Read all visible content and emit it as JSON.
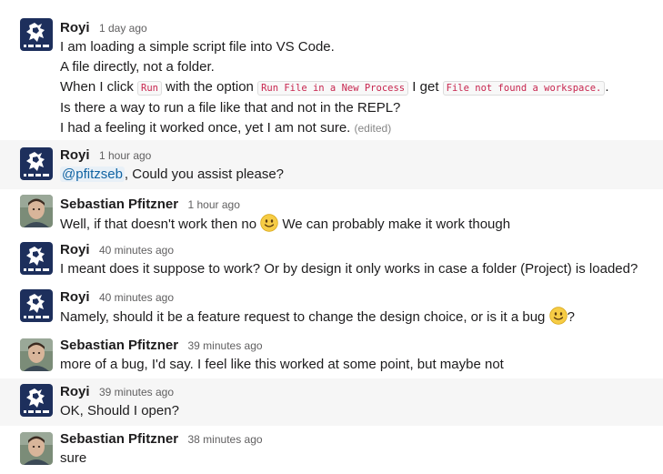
{
  "messages": [
    {
      "author": "Royi",
      "avatar": "royi-avatar",
      "time": "1 day ago",
      "lines": {
        "l1": "I am loading a simple script file into VS Code.",
        "l2": "A file directly, not a folder.",
        "l3a": "When I click",
        "l3code1": "Run",
        "l3b": "with the option",
        "l3code2": "Run File in a New Process",
        "l3c": "I get",
        "l3code3": "File not found a workspace.",
        "l3d": ".",
        "l4": "Is there a way to run a file like that and not in the REPL?",
        "l5": "I had a feeling it worked once, yet I am not sure.",
        "edited": "(edited)"
      }
    },
    {
      "author": "Royi",
      "avatar": "royi-avatar",
      "time": "1 hour ago",
      "mention": "@pfitzseb",
      "text": ", Could you assist please?"
    },
    {
      "author": "Sebastian Pfitzner",
      "avatar": "sebastian-avatar",
      "time": "1 hour ago",
      "text_a": "Well, if that doesn't work then no",
      "emoji": "slightly-smiling-face",
      "text_b": "We can probably make it work though"
    },
    {
      "author": "Royi",
      "avatar": "royi-avatar",
      "time": "40 minutes ago",
      "text": "I meant does it suppose to work? Or by design it only works in case a folder (Project) is loaded?"
    },
    {
      "author": "Royi",
      "avatar": "royi-avatar",
      "time": "40 minutes ago",
      "text_a": "Namely, should it be a feature request to change the design choice, or is it a bug",
      "emoji": "slightly-smiling-face",
      "text_b": "?"
    },
    {
      "author": "Sebastian Pfitzner",
      "avatar": "sebastian-avatar",
      "time": "39 minutes ago",
      "text": "more of a bug, I'd say. I feel like this worked at some point, but maybe not"
    },
    {
      "author": "Royi",
      "avatar": "royi-avatar",
      "time": "39 minutes ago",
      "text": "OK, Should I open?"
    },
    {
      "author": "Sebastian Pfitzner",
      "avatar": "sebastian-avatar",
      "time": "38 minutes ago",
      "text": "sure"
    }
  ],
  "colors": {
    "alt_row": "#f6f6f6",
    "mention": "#1264a3",
    "code": "#c7254e"
  }
}
